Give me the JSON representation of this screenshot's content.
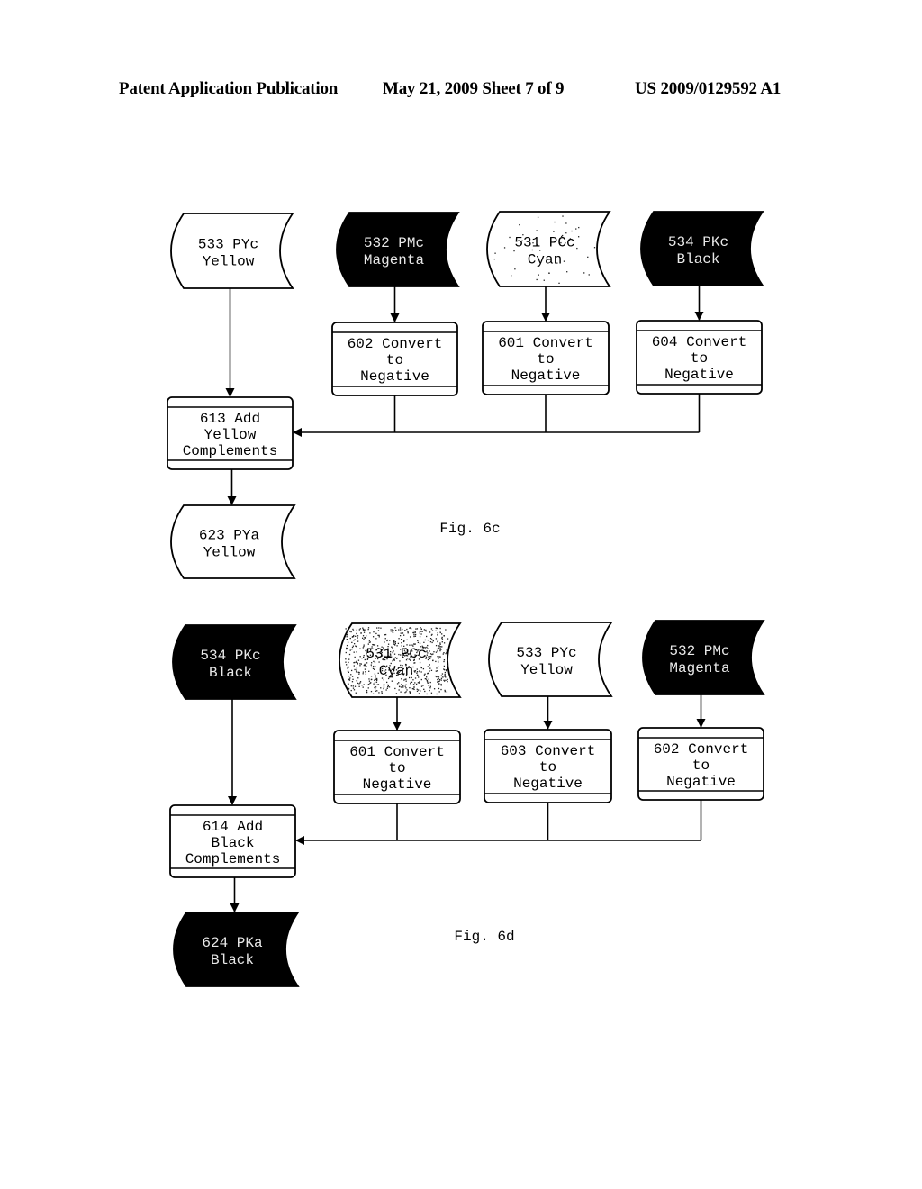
{
  "header": {
    "left": "Patent Application Publication",
    "middle": "May 21, 2009  Sheet 7 of 9",
    "right": "US 2009/0129592 A1"
  },
  "figures": [
    {
      "id": "fig6c",
      "caption": "Fig. 6c",
      "inputs": [
        {
          "id": "533",
          "line1": "533 PYc",
          "line2": "Yellow",
          "style": "white"
        },
        {
          "id": "532",
          "line1": "532 PMc",
          "line2": "Magenta",
          "style": "black"
        },
        {
          "id": "531",
          "line1": "531 PCc",
          "line2": "Cyan",
          "style": "speckled-light"
        },
        {
          "id": "534",
          "line1": "534 PKc",
          "line2": "Black",
          "style": "black"
        }
      ],
      "converters": [
        {
          "line1": "602 Convert",
          "line2": "to",
          "line3": "Negative"
        },
        {
          "line1": "601 Convert",
          "line2": "to",
          "line3": "Negative"
        },
        {
          "line1": "604 Convert",
          "line2": "to",
          "line3": "Negative"
        }
      ],
      "adder": {
        "line1": "613 Add",
        "line2": "Yellow",
        "line3": "Complements"
      },
      "output": {
        "line1": "623 PYa",
        "line2": "Yellow",
        "style": "white"
      }
    },
    {
      "id": "fig6d",
      "caption": "Fig. 6d",
      "inputs": [
        {
          "id": "534",
          "line1": "534 PKc",
          "line2": "Black",
          "style": "black"
        },
        {
          "id": "531",
          "line1": "531 PCc",
          "line2": "Cyan",
          "style": "speckled-heavy"
        },
        {
          "id": "533",
          "line1": "533 PYc",
          "line2": "Yellow",
          "style": "white"
        },
        {
          "id": "532",
          "line1": "532 PMc",
          "line2": "Magenta",
          "style": "black"
        }
      ],
      "converters": [
        {
          "line1": "601 Convert",
          "line2": "to",
          "line3": "Negative"
        },
        {
          "line1": "603 Convert",
          "line2": "to",
          "line3": "Negative"
        },
        {
          "line1": "602 Convert",
          "line2": "to",
          "line3": "Negative"
        }
      ],
      "adder": {
        "line1": "614 Add",
        "line2": "Black",
        "line3": "Complements"
      },
      "output": {
        "line1": "624 PKa",
        "line2": "Black",
        "style": "black"
      }
    }
  ]
}
